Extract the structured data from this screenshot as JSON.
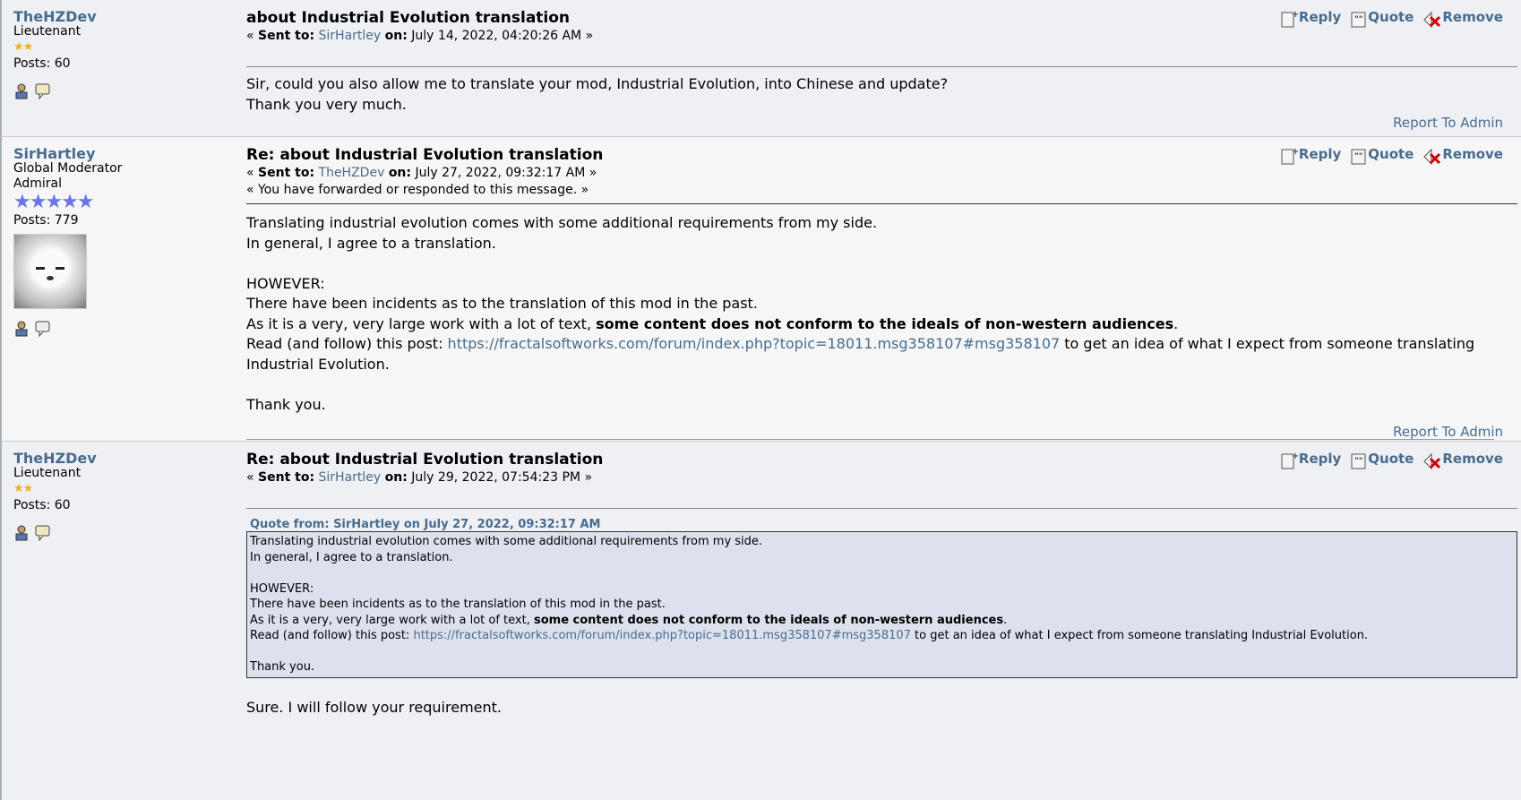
{
  "actions": {
    "reply": "Reply",
    "quote": "Quote",
    "remove": "Remove",
    "report": "Report To Admin"
  },
  "labels": {
    "sent_to": "Sent to:",
    "on": "on:",
    "open": "«",
    "close": "»",
    "posts": "Posts:"
  },
  "posts": [
    {
      "author": "TheHZDev",
      "title": "Lieutenant",
      "stars": "★★",
      "posts": "60",
      "subject": "about Industrial Evolution translation",
      "sent_to": "SirHartley",
      "date": "July 14, 2022, 04:20:26 AM",
      "body": [
        "Sir, could you also allow me to translate your mod, Industrial Evolution, into Chinese and update?",
        "Thank you very much."
      ]
    },
    {
      "author": "SirHartley",
      "group": "Global Moderator",
      "title": "Admiral",
      "stars": "★★★★★",
      "posts": "779",
      "subject": "Re: about Industrial Evolution translation",
      "sent_to": "TheHZDev",
      "date": "July 27, 2022, 09:32:17 AM",
      "note": "« You have forwarded or responded to this message. »",
      "body": {
        "l1": "Translating industrial evolution comes with some additional requirements from my side.",
        "l2": "In general, I agree to a translation.",
        "l3": "HOWEVER:",
        "l4": "There have been incidents as to the translation of this mod in the past.",
        "l5a": "As it is a very, very large work with a lot of text, ",
        "l5b": "some content does not conform to the ideals of non-western audiences",
        "l5c": ".",
        "l6a": "Read (and follow) this post: ",
        "l6link": "https://fractalsoftworks.com/forum/index.php?topic=18011.msg358107#msg358107",
        "l6b": " to get an idea of what I expect from someone translating Industrial Evolution.",
        "l7": "Thank you."
      }
    },
    {
      "author": "TheHZDev",
      "title": "Lieutenant",
      "stars": "★★",
      "posts": "60",
      "subject": "Re: about Industrial Evolution translation",
      "sent_to": "SirHartley",
      "date": "July 29, 2022, 07:54:23 PM",
      "quote_header": "Quote from: SirHartley on July 27, 2022, 09:32:17 AM",
      "reply": "Sure. I will follow your requirement."
    }
  ],
  "colors": {
    "link": "#476c8e",
    "admiral_stars": "#6c73e8",
    "lieutenant_stars": "#f0b020",
    "quote_bg": "#dde1ee"
  },
  "icons": [
    "reply-icon",
    "quote-icon",
    "remove-icon",
    "profile-icon",
    "pm-icon"
  ]
}
